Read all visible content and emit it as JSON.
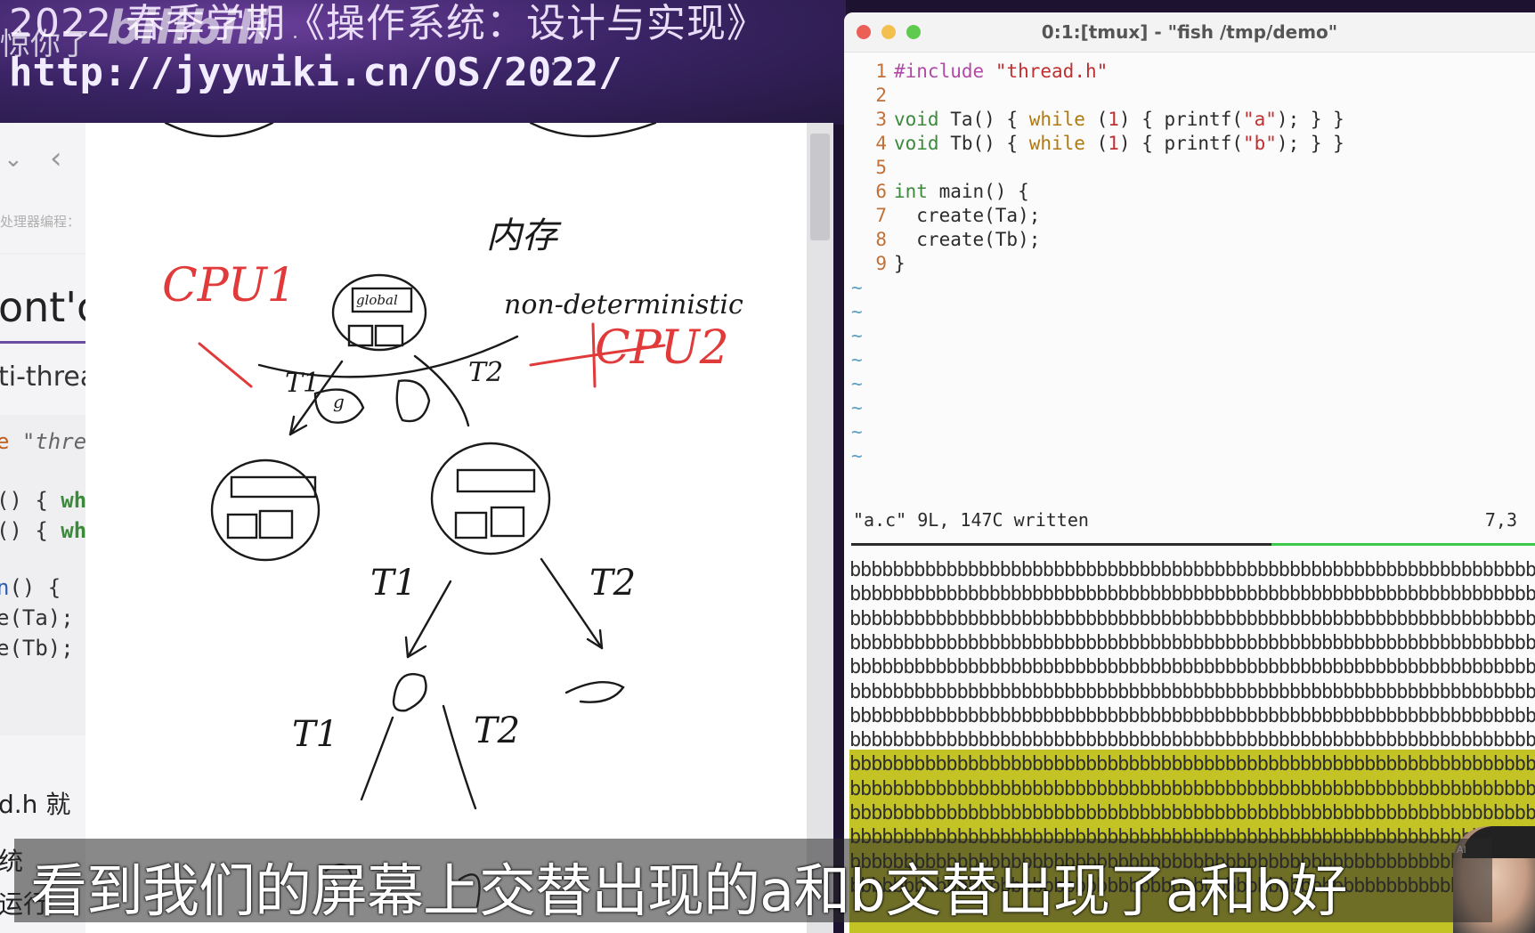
{
  "banner": {
    "title": "2022 春季学期《操作系统：设计与实现》",
    "url": "http://jyywiki.cn/OS/2022/",
    "watermark_text": "惊你了",
    "watermark_logo": "bilibili"
  },
  "left_panel": {
    "nav_down": "⌄",
    "nav_back": "‹",
    "crumb": "处理器编程：",
    "heading": "ont'c",
    "subheading": "ti-threa",
    "code_lines": [
      {
        "pre": "e",
        "str": " \"thre"
      },
      {
        "a": "() { ",
        "kw": "wh"
      },
      {
        "a": "() { ",
        "kw": "wh"
      },
      {
        "fn": "n",
        "a": "() {"
      },
      {
        "a": "e(Ta);"
      },
      {
        "a": "e(Tb);"
      }
    ],
    "tail_lines": [
      "d.h 就",
      "统",
      "运行"
    ]
  },
  "whiteboard": {
    "labels": {
      "cpu1": "CPU1",
      "cpu2": "CPU2",
      "global": "global",
      "nondet_cn": "内存",
      "nondet": "non-deterministic",
      "t1a": "T1",
      "t2a": "T2",
      "t1b": "T1",
      "t2b": "T2",
      "t1c": "T1",
      "t2c": "T2",
      "g": "g"
    }
  },
  "terminal": {
    "title": "0:1:[tmux] - \"fish /tmp/demo\"",
    "lines": [
      {
        "n": "1",
        "html_parts": [
          [
            "pp",
            "#include"
          ],
          [
            "",
            " "
          ],
          [
            "s",
            "\"thread.h\""
          ]
        ]
      },
      {
        "n": "2",
        "html_parts": []
      },
      {
        "n": "3",
        "html_parts": [
          [
            "ty",
            "void"
          ],
          [
            "",
            " Ta() { "
          ],
          [
            "k",
            "while"
          ],
          [
            "",
            " ("
          ],
          [
            "s",
            "1"
          ],
          [
            "",
            ") { printf("
          ],
          [
            "s",
            "\"a\""
          ],
          [
            "",
            "); } }"
          ]
        ]
      },
      {
        "n": "4",
        "html_parts": [
          [
            "ty",
            "void"
          ],
          [
            "",
            " Tb() { "
          ],
          [
            "k",
            "while"
          ],
          [
            "",
            " ("
          ],
          [
            "s",
            "1"
          ],
          [
            "",
            ") { printf("
          ],
          [
            "s",
            "\"b\""
          ],
          [
            "",
            "); } }"
          ]
        ]
      },
      {
        "n": "5",
        "html_parts": []
      },
      {
        "n": "6",
        "html_parts": [
          [
            "ty",
            "int"
          ],
          [
            "",
            " main() {"
          ]
        ]
      },
      {
        "n": "7",
        "html_parts": [
          [
            "",
            "  create(Ta);"
          ]
        ]
      },
      {
        "n": "8",
        "html_parts": [
          [
            "",
            "  create(Tb);"
          ]
        ]
      },
      {
        "n": "9",
        "html_parts": [
          [
            "",
            "}"
          ]
        ]
      }
    ],
    "tilde_count": 8,
    "status_text": "\"a.c\" 9L, 147C written",
    "cursor_pos": "7,3",
    "output_char": "b",
    "output_rows": 14
  },
  "avatar": {
    "badge": "AI"
  },
  "subtitle": {
    "text": "看到我们的屏幕上交替出现的a和b交替出现了a和b好"
  },
  "colors": {
    "pen_red": "#e03a3a",
    "pen_black": "#1a1a1a",
    "highlight": "#b8b800",
    "tmux_green": "#3cc84a"
  }
}
